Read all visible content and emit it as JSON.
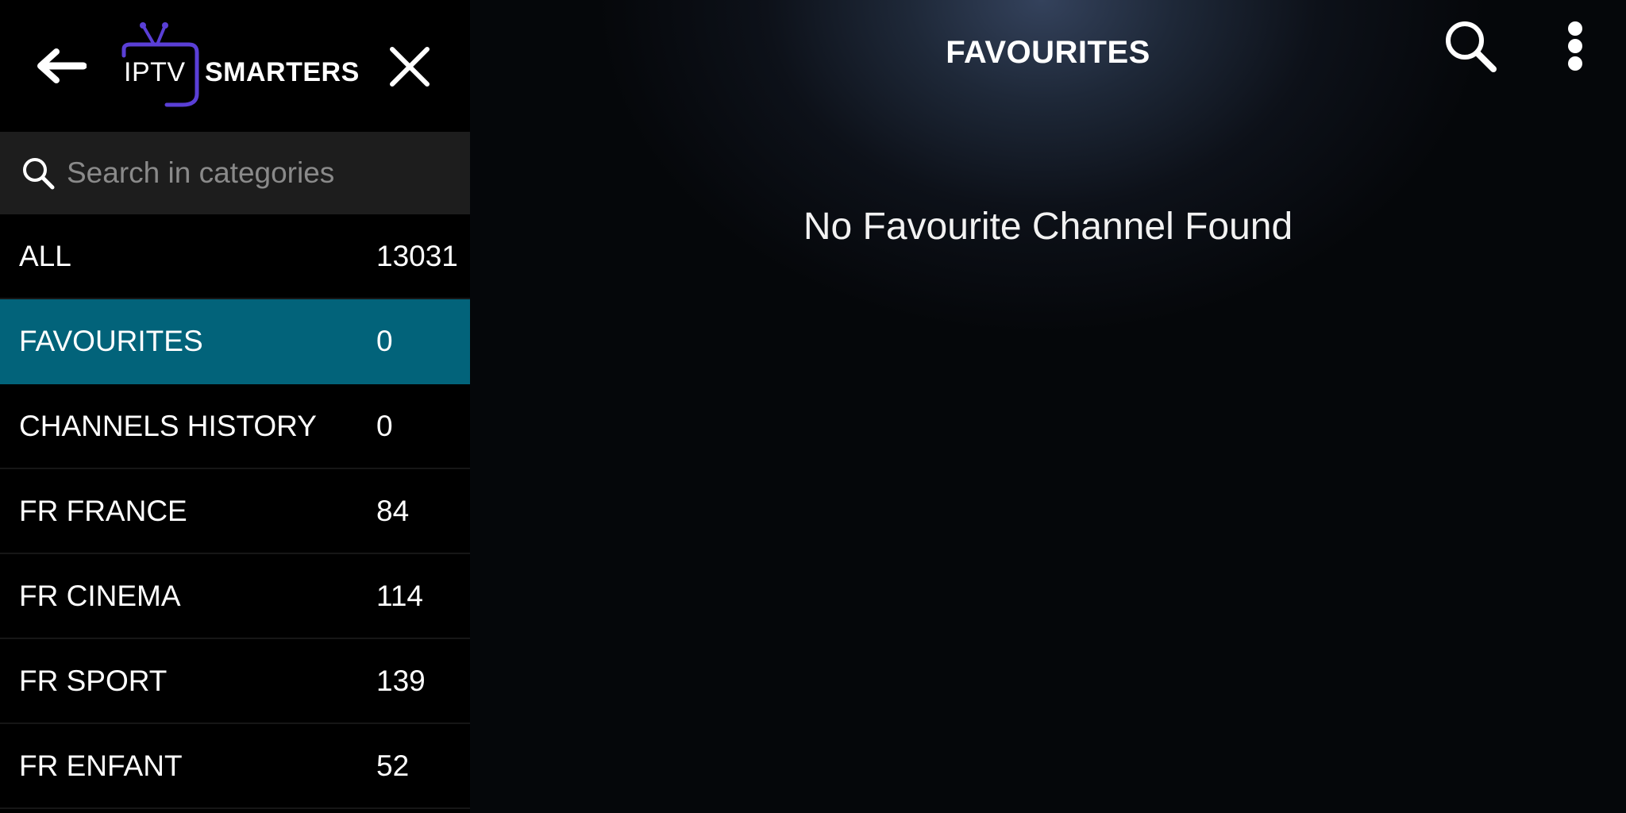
{
  "app": {
    "brand_left": "IPTV",
    "brand_right": "SMARTERS",
    "accent_color": "#02637a",
    "logo_color": "#5a3fd6"
  },
  "sidebar": {
    "back_icon": "arrow-left-icon",
    "close_icon": "close-icon",
    "search": {
      "icon": "search-icon",
      "placeholder": "Search in categories",
      "value": ""
    },
    "categories": [
      {
        "label": "ALL",
        "count": "13031",
        "active": false
      },
      {
        "label": "FAVOURITES",
        "count": "0",
        "active": true
      },
      {
        "label": "CHANNELS HISTORY",
        "count": "0",
        "active": false
      },
      {
        "label": "FR FRANCE",
        "count": "84",
        "active": false
      },
      {
        "label": "FR CINEMA",
        "count": "114",
        "active": false
      },
      {
        "label": "FR SPORT",
        "count": "139",
        "active": false
      },
      {
        "label": "FR ENFANT",
        "count": "52",
        "active": false
      }
    ]
  },
  "main": {
    "title": "FAVOURITES",
    "search_icon": "search-icon",
    "menu_icon": "more-vertical-icon",
    "empty_message": "No Favourite Channel Found"
  }
}
